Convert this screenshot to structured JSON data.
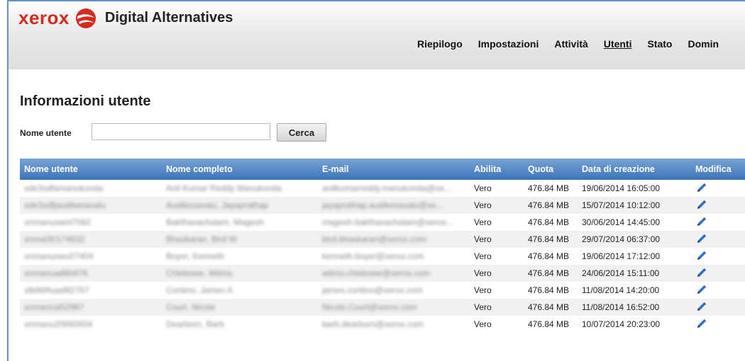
{
  "app": {
    "brand": "xerox",
    "title": "Digital Alternatives",
    "brand_color": "#d52b1e",
    "accent_color": "#3d74b8"
  },
  "nav": {
    "items": [
      "Riepilogo",
      "Impostazioni",
      "Attività",
      "Utenti",
      "Stato",
      "Domin"
    ],
    "active": "Utenti"
  },
  "page": {
    "title": "Informazioni utente"
  },
  "search": {
    "label": "Nome utente",
    "value": "",
    "button": "Cerca"
  },
  "table": {
    "columns": [
      "Nome utente",
      "Nome completo",
      "E-mail",
      "Abilita",
      "Quota",
      "Data di creazione",
      "Modifica"
    ],
    "rows": [
      {
        "username": "xde3sdfamanukonda",
        "fullname": "Anil Kumar Reddy Manukonda",
        "email": "anilkumarreddy.manukonda@xe...",
        "enabled": "Vero",
        "quota": "476.84 MB",
        "created": "19/06/2014 16:05:00"
      },
      {
        "username": "xde3sdfjaudikesavalu",
        "fullname": "Audikesavalu, Jayaprathap",
        "email": "jayaprathap.audikesavalu@xe...",
        "enabled": "Vero",
        "quota": "476.84 MB",
        "created": "15/07/2014 10:12:00"
      },
      {
        "username": "xnmanuswnt7062",
        "fullname": "Bakthavachalam, Magesh",
        "email": "magesh.bakthavachalam@xerox...",
        "enabled": "Vero",
        "quota": "476.84 MB",
        "created": "30/06/2014 14:45:00"
      },
      {
        "username": "xnmal30174632",
        "fullname": "Bhaskaran, Bird W",
        "email": "bird.bhaskaran@xerox.com",
        "enabled": "Vero",
        "quota": "476.84 MB",
        "created": "29/07/2014 06:37:00"
      },
      {
        "username": "xnmanuswu07404",
        "fullname": "Boyer, Kenneth",
        "email": "kenneth.boyer@xerox.com",
        "enabled": "Vero",
        "quota": "476.84 MB",
        "created": "19/06/2014 17:12:00"
      },
      {
        "username": "xnmanuad80476",
        "fullname": "Chlebowe, Wilma",
        "email": "wilma.chlebowe@xerox.com",
        "enabled": "Vero",
        "quota": "476.84 MB",
        "created": "24/06/2014 15:11:00"
      },
      {
        "username": "x8dWAuad82767",
        "fullname": "Contino, James A",
        "email": "james.contino@xerox.com",
        "enabled": "Vero",
        "quota": "476.84 MB",
        "created": "11/08/2014 14:20:00"
      },
      {
        "username": "xnmancal52967",
        "fullname": "Court, Nicole",
        "email": "Nicole.Court@xerox.com",
        "enabled": "Vero",
        "quota": "476.84 MB",
        "created": "11/08/2014 16:52:00"
      },
      {
        "username": "xnmanu20892604",
        "fullname": "Dearborn, Barb",
        "email": "barb.dearborn@xerox.com",
        "enabled": "Vero",
        "quota": "476.84 MB",
        "created": "10/07/2014 20:23:00"
      }
    ]
  },
  "icons": {
    "edit": "pencil-icon",
    "logo": "xerox-globe-icon"
  }
}
